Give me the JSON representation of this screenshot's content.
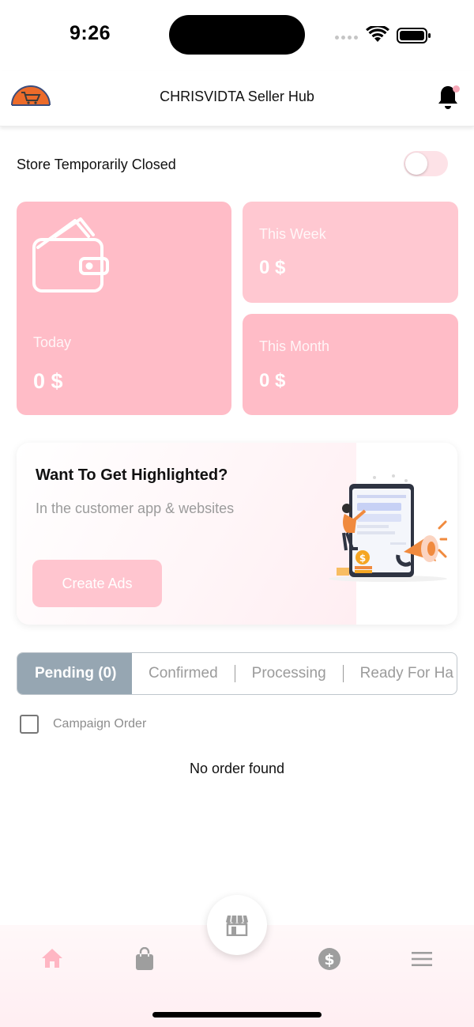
{
  "status_bar": {
    "time": "9:26"
  },
  "header": {
    "title": "CHRISVIDTA Seller Hub",
    "logo_icon": "shopping-cart-logo",
    "notification_icon": "bell-icon",
    "notification_dot_color": "#f6a8b8"
  },
  "store_status": {
    "label": "Store Temporarily Closed",
    "toggle_on": false
  },
  "earnings": {
    "today": {
      "label": "Today",
      "value": "0 $"
    },
    "week": {
      "label": "This Week",
      "value": "0 $"
    },
    "month": {
      "label": "This Month",
      "value": "0 $"
    },
    "card_color": "#ffbcc7"
  },
  "ads_banner": {
    "title": "Want To Get Highlighted?",
    "subtitle": "In the customer app & websites",
    "button_label": "Create Ads",
    "illustration_icon": "advertising-illustration"
  },
  "order_tabs": [
    {
      "label": "Pending (0)",
      "active": true
    },
    {
      "label": "Confirmed",
      "active": false
    },
    {
      "label": "Processing",
      "active": false
    },
    {
      "label": "Ready For Ha",
      "active": false
    }
  ],
  "campaign": {
    "label": "Campaign Order",
    "checked": false
  },
  "orders": {
    "empty_message": "No order found"
  },
  "bottom_nav": {
    "items": [
      "home-icon",
      "shopping-bag-icon",
      "store-icon",
      "dollar-icon",
      "menu-icon"
    ],
    "accent": "#ffb6c3"
  }
}
